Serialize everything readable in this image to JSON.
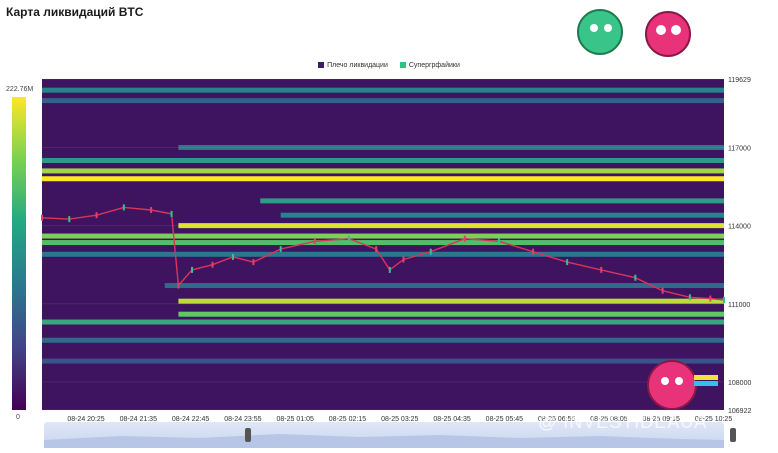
{
  "title": "Карта ликвидаций BTC",
  "legend": [
    {
      "label": "Плечо ликвидации",
      "color": "#3b1c6e"
    },
    {
      "label": "Супергрфайики",
      "color": "#2ec27e"
    }
  ],
  "colorbar": {
    "max_label": "222.76M",
    "min_label": "0"
  },
  "watermark": "@ INVESTIDEAUA",
  "chart_data": {
    "type": "heatmap",
    "title": "Карта ликвидаций BTC",
    "x_ticks": [
      "08-24 20:25",
      "08-24 21:35",
      "08-24 22:45",
      "08-24 23:55",
      "08-25 01:05",
      "08-25 02:15",
      "08-25 03:25",
      "08-25 04:35",
      "08-25 05:45",
      "08-25 06:55",
      "08-25 08:05",
      "08-25 09:15",
      "08-25 10:25"
    ],
    "y_ticks": [
      106922,
      108000,
      111000,
      114000,
      117000,
      119629
    ],
    "ylim": [
      106922,
      119629
    ],
    "colorbar_range": [
      "0",
      "222.76M"
    ],
    "liquidation_bands": [
      {
        "price": 119200,
        "from": 0.0,
        "intensity": 0.45
      },
      {
        "price": 118800,
        "from": 0.0,
        "intensity": 0.3
      },
      {
        "price": 117000,
        "from": 0.2,
        "intensity": 0.4
      },
      {
        "price": 116500,
        "from": 0.0,
        "intensity": 0.55
      },
      {
        "price": 116100,
        "from": 0.0,
        "intensity": 0.85
      },
      {
        "price": 115800,
        "from": 0.0,
        "intensity": 1.0
      },
      {
        "price": 114950,
        "from": 0.32,
        "intensity": 0.55
      },
      {
        "price": 114400,
        "from": 0.35,
        "intensity": 0.45
      },
      {
        "price": 114000,
        "from": 0.2,
        "intensity": 0.95
      },
      {
        "price": 113600,
        "from": 0.0,
        "intensity": 0.8
      },
      {
        "price": 113350,
        "from": 0.0,
        "intensity": 0.7
      },
      {
        "price": 112900,
        "from": 0.0,
        "intensity": 0.4
      },
      {
        "price": 111700,
        "from": 0.18,
        "intensity": 0.35
      },
      {
        "price": 111100,
        "from": 0.2,
        "intensity": 0.9
      },
      {
        "price": 110600,
        "from": 0.2,
        "intensity": 0.75
      },
      {
        "price": 110300,
        "from": 0.0,
        "intensity": 0.6
      },
      {
        "price": 109600,
        "from": 0.0,
        "intensity": 0.35
      },
      {
        "price": 108800,
        "from": 0.0,
        "intensity": 0.25
      }
    ],
    "price_series": [
      {
        "t": 0.0,
        "p": 114300
      },
      {
        "t": 0.04,
        "p": 114250
      },
      {
        "t": 0.08,
        "p": 114400
      },
      {
        "t": 0.12,
        "p": 114700
      },
      {
        "t": 0.16,
        "p": 114600
      },
      {
        "t": 0.19,
        "p": 114450
      },
      {
        "t": 0.2,
        "p": 111700
      },
      {
        "t": 0.22,
        "p": 112300
      },
      {
        "t": 0.25,
        "p": 112500
      },
      {
        "t": 0.28,
        "p": 112800
      },
      {
        "t": 0.31,
        "p": 112600
      },
      {
        "t": 0.35,
        "p": 113100
      },
      {
        "t": 0.4,
        "p": 113400
      },
      {
        "t": 0.45,
        "p": 113500
      },
      {
        "t": 0.49,
        "p": 113100
      },
      {
        "t": 0.51,
        "p": 112300
      },
      {
        "t": 0.53,
        "p": 112700
      },
      {
        "t": 0.57,
        "p": 113000
      },
      {
        "t": 0.62,
        "p": 113500
      },
      {
        "t": 0.67,
        "p": 113400
      },
      {
        "t": 0.72,
        "p": 113000
      },
      {
        "t": 0.77,
        "p": 112600
      },
      {
        "t": 0.82,
        "p": 112300
      },
      {
        "t": 0.87,
        "p": 112000
      },
      {
        "t": 0.91,
        "p": 111500
      },
      {
        "t": 0.95,
        "p": 111250
      },
      {
        "t": 0.98,
        "p": 111200
      },
      {
        "t": 1.0,
        "p": 111150
      }
    ]
  }
}
